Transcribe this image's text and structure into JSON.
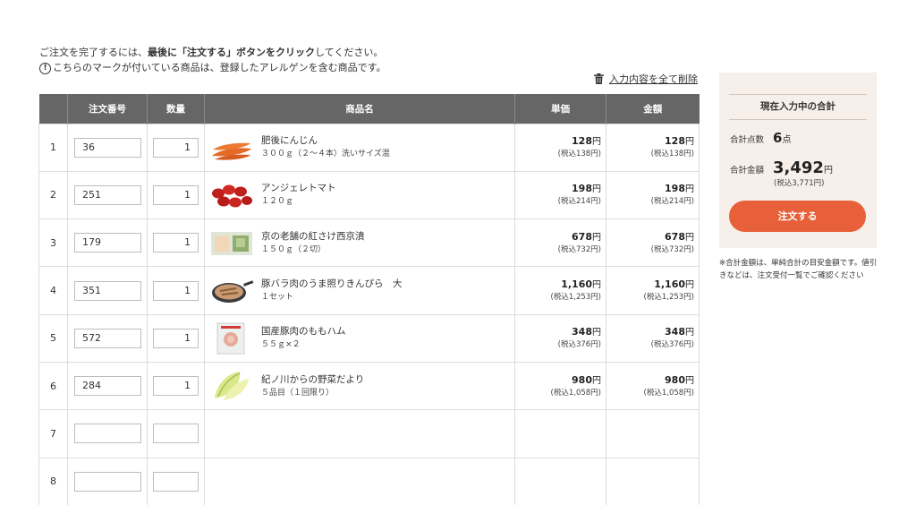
{
  "notice": {
    "line1_pre": "ご注文を完了するには、",
    "line1_bold": "最後に「注文する」ボタンをクリック",
    "line1_post": "してください。",
    "allergen_mark": "!",
    "line2": "こちらのマークが付いている商品は、登録したアレルゲンを含む商品です。"
  },
  "clear_all_label": "入力内容を全て削除",
  "table": {
    "headers": [
      "",
      "注文番号",
      "数量",
      "商品名",
      "単価",
      "金額"
    ],
    "rows": [
      {
        "no": "1",
        "code": "36",
        "qty": "1",
        "name": "肥後にんじん",
        "desc": "３００ｇ（２～４本）洗いサイズ混",
        "unit_price": "128",
        "unit_tax": "(税込138円)",
        "amount": "128",
        "amount_tax": "(税込138円)"
      },
      {
        "no": "2",
        "code": "251",
        "qty": "1",
        "name": "アンジェレトマト",
        "desc": "１２０ｇ",
        "unit_price": "198",
        "unit_tax": "(税込214円)",
        "amount": "198",
        "amount_tax": "(税込214円)"
      },
      {
        "no": "3",
        "code": "179",
        "qty": "1",
        "name": "京の老舗の紅さけ西京漬",
        "desc": "１５０ｇ（２切）",
        "unit_price": "678",
        "unit_tax": "(税込732円)",
        "amount": "678",
        "amount_tax": "(税込732円)"
      },
      {
        "no": "4",
        "code": "351",
        "qty": "1",
        "name": "豚バラ肉のうま照りきんぴら　大",
        "desc": "１セット",
        "unit_price": "1,160",
        "unit_tax": "(税込1,253円)",
        "amount": "1,160",
        "amount_tax": "(税込1,253円)"
      },
      {
        "no": "5",
        "code": "572",
        "qty": "1",
        "name": "国産豚肉のももハム",
        "desc": "５５ｇ×２",
        "unit_price": "348",
        "unit_tax": "(税込376円)",
        "amount": "348",
        "amount_tax": "(税込376円)"
      },
      {
        "no": "6",
        "code": "284",
        "qty": "1",
        "name": "紀ノ川からの野菜だより",
        "desc": "５品目（１回限り）",
        "unit_price": "980",
        "unit_tax": "(税込1,058円)",
        "amount": "980",
        "amount_tax": "(税込1,058円)"
      },
      {
        "no": "7",
        "code": "",
        "qty": ""
      },
      {
        "no": "8",
        "code": "",
        "qty": ""
      }
    ],
    "yen": "円"
  },
  "summary": {
    "title": "現在入力中の合計",
    "count_label": "合計点数",
    "count": "6",
    "count_unit": "点",
    "amount_label": "合計金額",
    "amount": "3,492",
    "amount_unit": "円",
    "amount_tax": "(税込3,771円)",
    "order_button": "注文する"
  },
  "note": "※合計金額は、単純合計の目安金額です。値引きなどは、注文受付一覧でご確認ください",
  "colors": {
    "header_bg": "#666666",
    "summary_bg": "#f7efe9",
    "accent": "#e8603a"
  },
  "icons": {
    "clear_all": "trash-icon",
    "allergen": "exclamation-circle-icon"
  }
}
